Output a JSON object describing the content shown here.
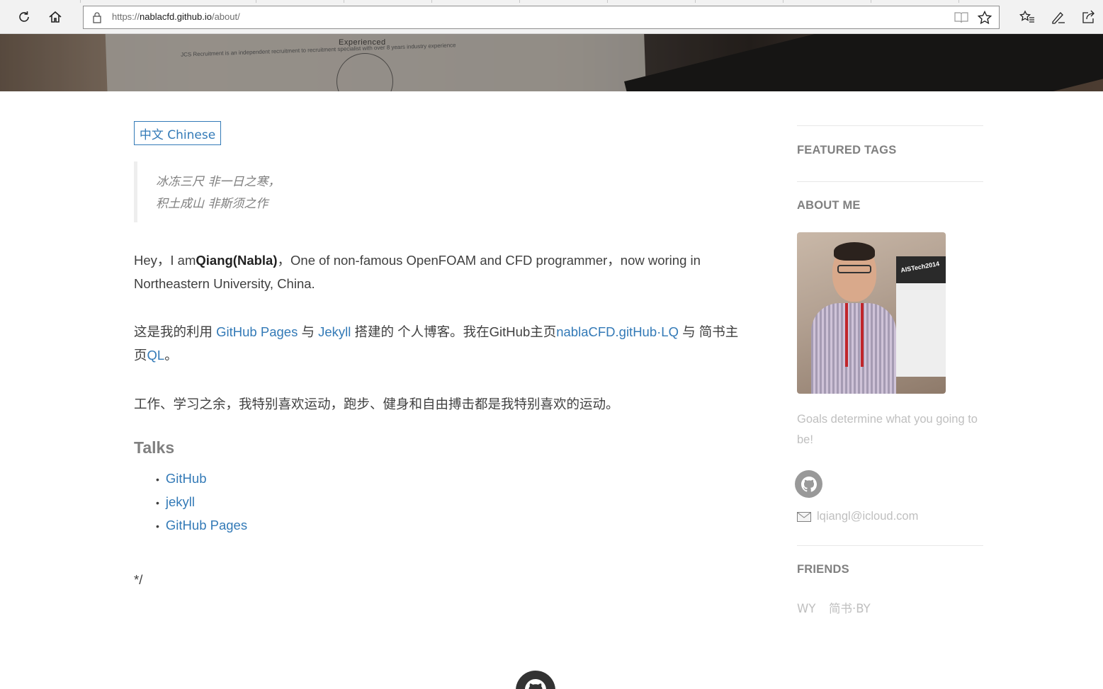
{
  "browser": {
    "url_prefix": "https://",
    "url_host": "nablacfd.github.io",
    "url_path": "/about/"
  },
  "banner": {
    "paper_heading": "Experienced",
    "paper_subtext": "JCS Recruitment is an independent recruitment to recruitment specialist with over 8 years industry experience"
  },
  "main": {
    "language_button": "中文 Chinese",
    "quote_line1": "冰冻三尺 非一日之寒，",
    "quote_line2": "积土成山 非斯须之作",
    "intro": {
      "pre": "Hey，I am",
      "name": "Qiang(Nabla)",
      "post": "，One of non-famous OpenFOAM and CFD programmer，now woring in Northeastern University, China."
    },
    "blog": {
      "t1": "这是我的利用 ",
      "link1": "GitHub Pages",
      "t2": " 与 ",
      "link2": "Jekyll",
      "t3": " 搭建的 个人博客。我在GitHub主页",
      "link3": "nablaCFD.gitHub·LQ",
      "t4": " 与 简书主页",
      "link4": "QL",
      "t5": "。"
    },
    "hobby": "工作、学习之余，我特别喜欢运动，跑步、健身和自由搏击都是我特别喜欢的运动。",
    "talks_heading": "Talks",
    "talks": [
      "GitHub",
      "jekyll",
      "GitHub Pages"
    ],
    "closing": "*/"
  },
  "sidebar": {
    "featured_tags": "FEATURED TAGS",
    "about_me": "ABOUT ME",
    "poster_title": "AISTech2014",
    "goals": "Goals determine what you going to be!",
    "email": "lqiangl@icloud.com",
    "friends_heading": "FRIENDS",
    "friends": [
      "WY",
      "简书·BY"
    ]
  },
  "colors": {
    "link": "#337ab7",
    "muted": "#bfbfbf",
    "heading_gray": "#808080"
  }
}
